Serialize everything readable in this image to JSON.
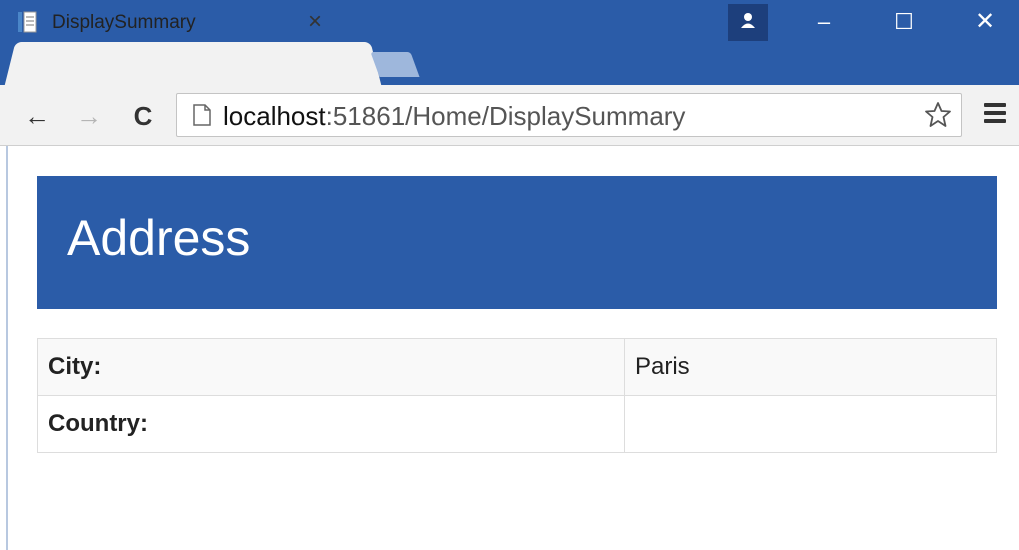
{
  "browser": {
    "tab_title": "DisplaySummary",
    "tab_close": "×",
    "url_host": "localhost",
    "url_rest": ":51861/Home/DisplaySummary",
    "window_controls": {
      "minimize": "–",
      "maximize": "☐",
      "close": "✕"
    },
    "nav": {
      "back": "←",
      "forward": "→",
      "reload": "C"
    },
    "icons": [
      "page-favicon-icon",
      "profile-icon",
      "page-icon",
      "star-icon",
      "menu-icon"
    ],
    "accent_color": "#2b5ca8"
  },
  "page": {
    "header_title": "Address",
    "rows": [
      {
        "label": "City:",
        "value": "Paris"
      },
      {
        "label": "Country:",
        "value": ""
      }
    ]
  }
}
